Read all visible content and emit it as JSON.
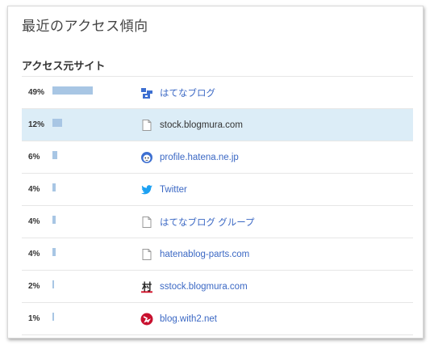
{
  "panel": {
    "title": "最近のアクセス傾向",
    "section_heading": "アクセス元サイト"
  },
  "referrers": [
    {
      "percent": "49%",
      "share": 0.49,
      "label": "はてなブログ",
      "icon": "hatena-blog-icon",
      "selected": false
    },
    {
      "percent": "12%",
      "share": 0.12,
      "label": "stock.blogmura.com",
      "icon": "document-icon",
      "selected": true
    },
    {
      "percent": "6%",
      "share": 0.06,
      "label": "profile.hatena.ne.jp",
      "icon": "hatena-profile-icon",
      "selected": false
    },
    {
      "percent": "4%",
      "share": 0.04,
      "label": "Twitter",
      "icon": "twitter-bird-icon",
      "selected": false
    },
    {
      "percent": "4%",
      "share": 0.04,
      "label": "はてなブログ グループ",
      "icon": "document-icon",
      "selected": false
    },
    {
      "percent": "4%",
      "share": 0.04,
      "label": "hatenablog-parts.com",
      "icon": "document-icon",
      "selected": false
    },
    {
      "percent": "2%",
      "share": 0.02,
      "label": "sstock.blogmura.com",
      "icon": "blogmura-icon",
      "selected": false
    },
    {
      "percent": "1%",
      "share": 0.01,
      "label": "blog.with2.net",
      "icon": "with2-ranking-icon",
      "selected": false
    }
  ],
  "colors": {
    "bar": "#a8c6e4",
    "link": "#3b68c4",
    "selected_row": "#dcedf7"
  }
}
